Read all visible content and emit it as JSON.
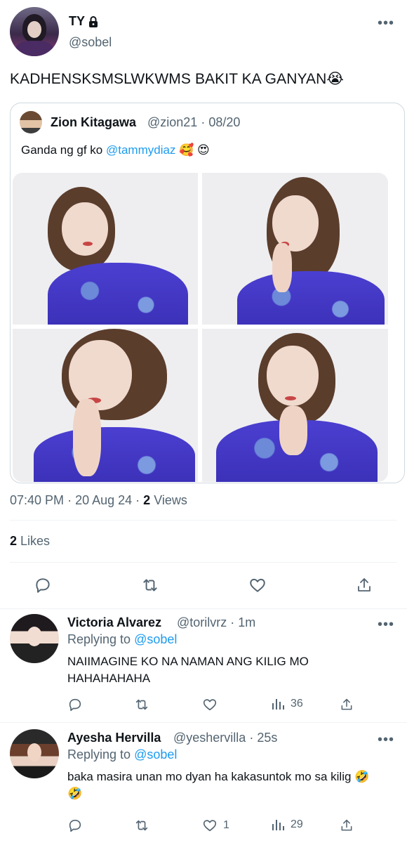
{
  "tweet": {
    "author_name": "TY",
    "author_handle": "@sobel",
    "text": "KADHENSKSMSLWKWMS BAKIT KA GANYAN😭",
    "time": "07:40 PM",
    "date": "20 Aug 24",
    "views_count": "2",
    "views_label": "Views",
    "likes_count": "2",
    "likes_label": "Likes"
  },
  "quote": {
    "author_name": "Zion Kitagawa",
    "author_handle": "@zion21",
    "date": "08/20",
    "text_prefix": "Ganda ng gf ko ",
    "mention": "@tammydiaz",
    "emojis": "🥰 😍"
  },
  "replies": [
    {
      "author_name": "Victoria Alvarez",
      "author_handle": "@torilvrz",
      "time": "1m",
      "replying_label": "Replying to",
      "replying_handle": "@sobel",
      "text": "NAIIMAGINE KO NA NAMAN ANG KILIG MO HAHAHAHAHA",
      "likes": "",
      "views": "36"
    },
    {
      "author_name": "Ayesha Hervilla",
      "author_handle": "@yeshervilla",
      "time": "25s",
      "replying_label": "Replying to",
      "replying_handle": "@sobel",
      "text": "baka masira unan mo dyan ha kakasuntok mo sa kilig 🤣 🤣",
      "likes": "1",
      "views": "29"
    }
  ],
  "icons": {
    "reply": "reply-icon",
    "retweet": "retweet-icon",
    "like": "heart-icon",
    "share": "share-icon",
    "views": "views-icon",
    "more": "more-icon",
    "lock": "lock-icon"
  },
  "colors": {
    "link": "#1d9bf0",
    "muted": "#536471",
    "text": "#0f1419"
  }
}
